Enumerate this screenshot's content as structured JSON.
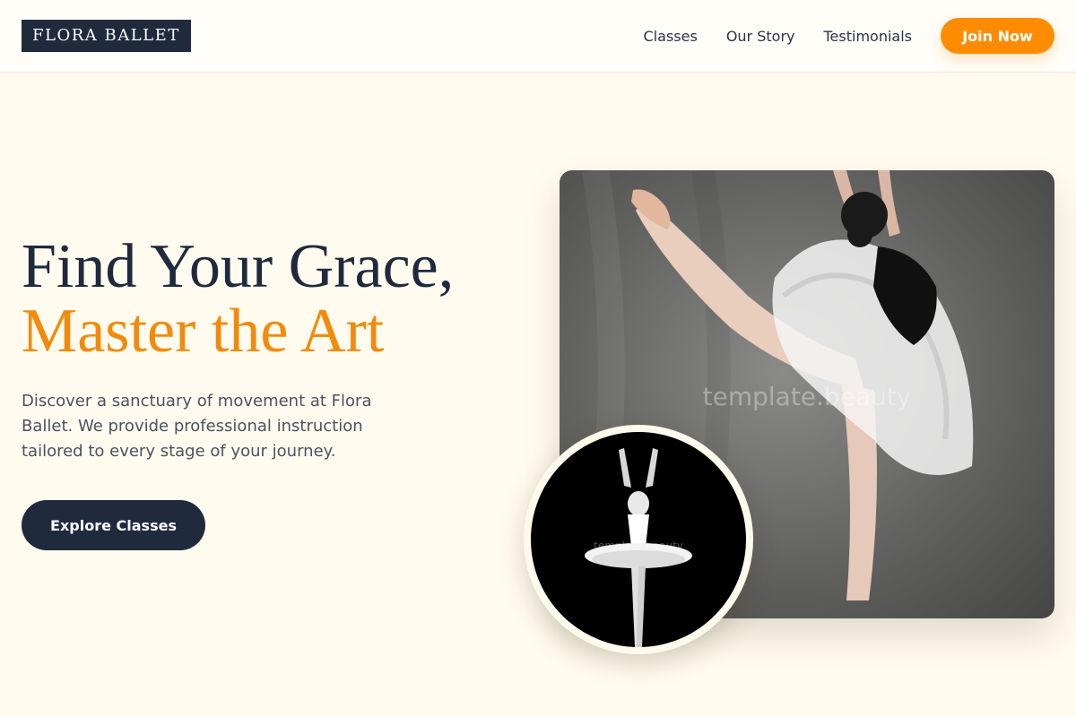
{
  "brand": {
    "logo_text": "FLORA BALLET"
  },
  "nav": {
    "links": [
      "Classes",
      "Our Story",
      "Testimonials"
    ],
    "cta_label": "Join Now"
  },
  "hero": {
    "title_line1": "Find Your Grace,",
    "title_line2": "Master the Art",
    "description": "Discover a sanctuary of movement at Flora Ballet. We provide professional instruction tailored to every stage of your journey.",
    "cta_label": "Explore Classes"
  },
  "images": {
    "main_watermark": "template.beauty",
    "circle_watermark": "template.beauty"
  },
  "colors": {
    "background": "#fffbee",
    "navy": "#1f2a3d",
    "accent_orange": "#ff8c00"
  }
}
